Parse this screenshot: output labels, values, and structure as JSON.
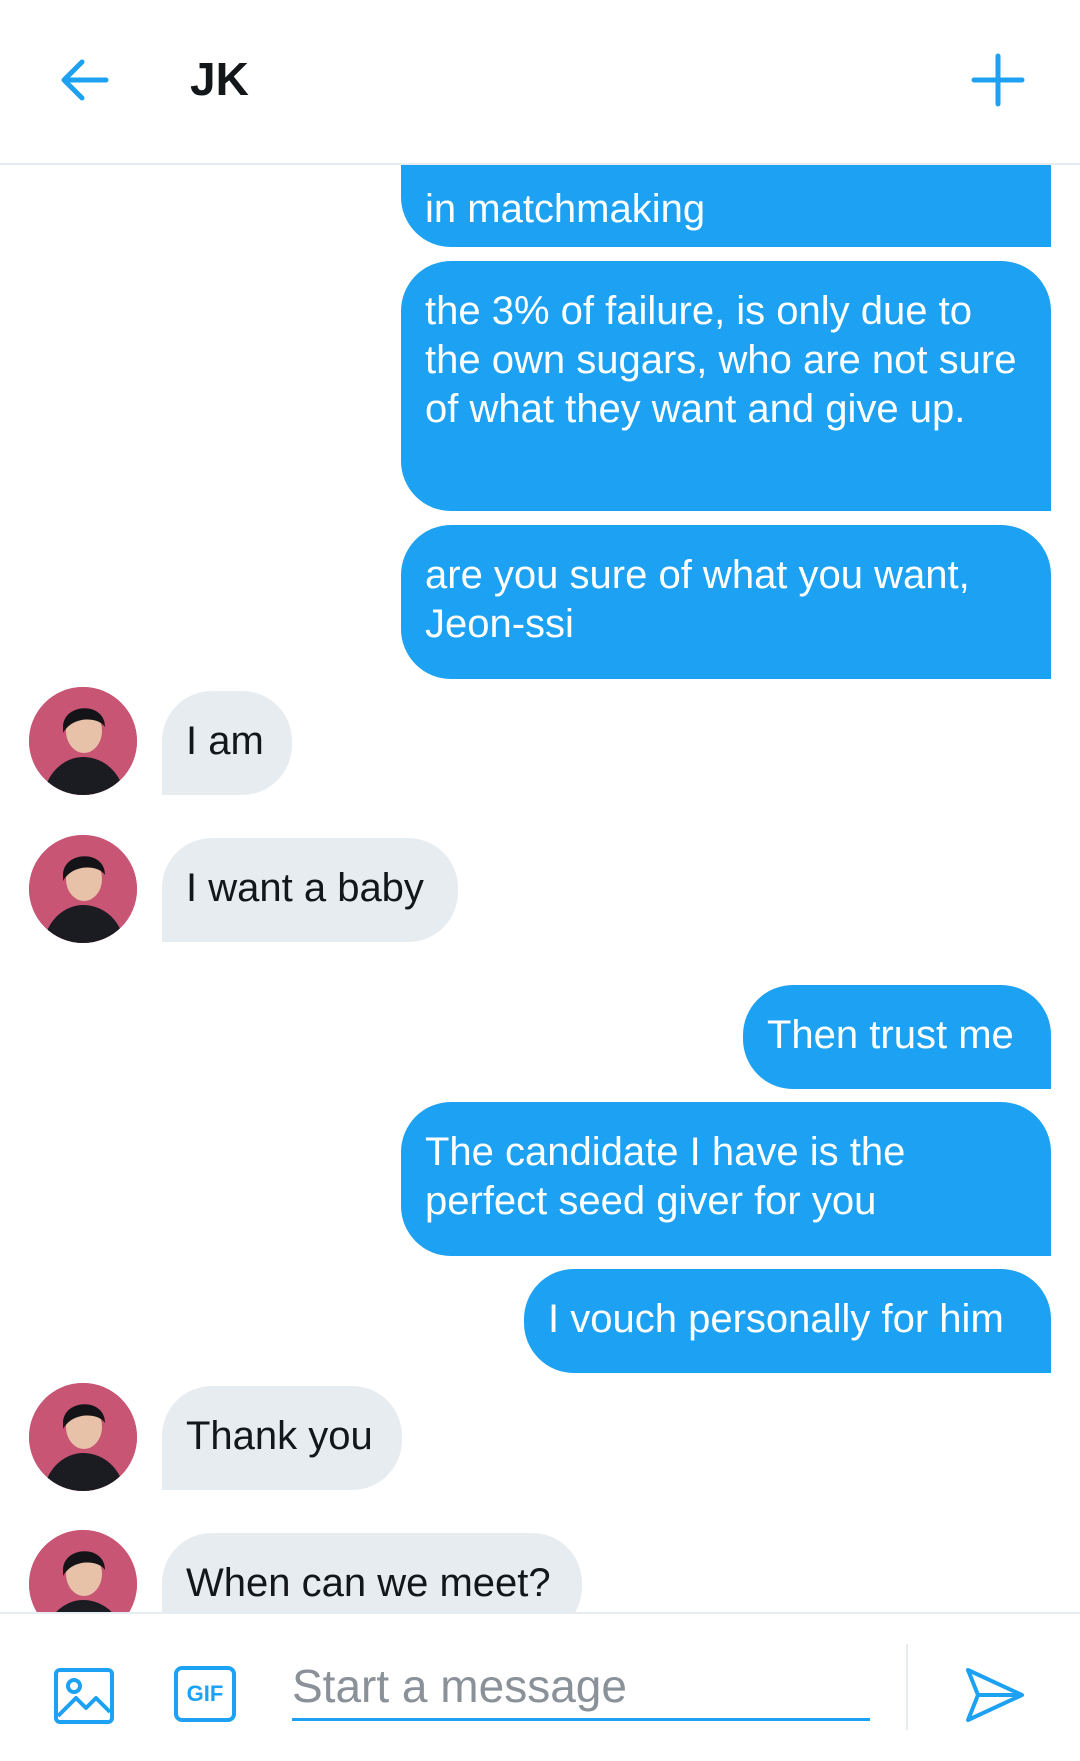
{
  "header": {
    "title": "JK",
    "back_icon": "arrow-left-icon",
    "add_icon": "plus-icon"
  },
  "messages": [
    {
      "from": "me",
      "text": "in matchmaking"
    },
    {
      "from": "me",
      "text": "the 3% of failure, is only due to the own sugars, who are not sure of what they want and give up."
    },
    {
      "from": "me",
      "text": "are you sure of what you want, Jeon-ssi"
    },
    {
      "from": "them",
      "text": "I am"
    },
    {
      "from": "them",
      "text": "I want a baby"
    },
    {
      "from": "me",
      "text": "Then trust me"
    },
    {
      "from": "me",
      "text": "The candidate I have is the perfect seed giver for you"
    },
    {
      "from": "me",
      "text": "I vouch personally for him"
    },
    {
      "from": "them",
      "text": "Thank you"
    },
    {
      "from": "them",
      "text": "When can we meet?"
    }
  ],
  "composer": {
    "placeholder": "Start a message",
    "gif_label": "GIF",
    "media_icon": "image-icon",
    "send_icon": "send-icon"
  },
  "colors": {
    "accent": "#1da1f2",
    "received_bubble": "#e6ecf0",
    "text": "#14171a",
    "avatar_bg": "#c85574"
  }
}
